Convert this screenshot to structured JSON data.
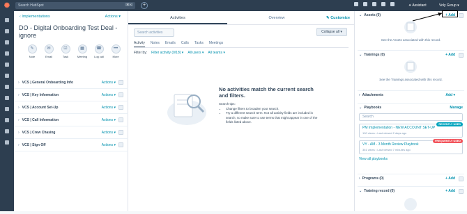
{
  "topbar": {
    "search_placeholder": "Search HubSpot",
    "search_shortcut": "⌘ K",
    "assistant_label": "Assistant",
    "account_label": "Voly Group"
  },
  "record": {
    "breadcrumb": "Implementations",
    "actions_label": "Actions",
    "title": "DO - Digital Onboarding Test Deal - ignore",
    "quick_actions": [
      {
        "label": "Note",
        "icon": "note-icon",
        "glyph": "✎"
      },
      {
        "label": "Email",
        "icon": "email-icon",
        "glyph": "✉"
      },
      {
        "label": "Task",
        "icon": "task-icon",
        "glyph": "☑"
      },
      {
        "label": "Meeting",
        "icon": "meeting-icon",
        "glyph": "▦"
      },
      {
        "label": "Log call",
        "icon": "call-icon",
        "glyph": "☎"
      },
      {
        "label": "More",
        "icon": "more-icon",
        "glyph": "•••"
      }
    ],
    "sections": [
      {
        "title": "VCS | General Onboarding Info",
        "actions": "Actions"
      },
      {
        "title": "VCS | Key Information",
        "actions": "Actions"
      },
      {
        "title": "VCS | Account Set-Up",
        "actions": "Actions"
      },
      {
        "title": "VCS | Call Information",
        "actions": "Actions"
      },
      {
        "title": "VCS | Crew Chasing",
        "actions": "Actions"
      },
      {
        "title": "VCS | Sign Off",
        "actions": "Actions"
      }
    ]
  },
  "middle": {
    "tabs": [
      "Activities",
      "Overview"
    ],
    "customize_label": "Customize",
    "search_placeholder": "Search activities",
    "collapse_label": "Collapse all",
    "subtabs": [
      "Activity",
      "Notes",
      "Emails",
      "Calls",
      "Tasks",
      "Meetings"
    ],
    "filter_by_label": "Filter by:",
    "filter_activity": "Filter activity (0/18)",
    "filter_users": "All users",
    "filter_teams": "All teams",
    "empty_title": "No activities match the current search and filters.",
    "tips_heading": "Search tips:",
    "tips": [
      "Change filters to broaden your search.",
      "Try a different search term. Not all activity fields are included in search, so make sure to use terms that might appear in one of the fields listed above."
    ]
  },
  "right": {
    "assets": {
      "title": "Assets (0)",
      "add": "+ Add",
      "empty": "See the Assets associated with this record."
    },
    "trainings": {
      "title": "Trainings (0)",
      "add": "+ Add",
      "empty": "See the Trainings associated with this record."
    },
    "attachments": {
      "title": "Attachments",
      "add": "Add"
    },
    "playbooks": {
      "title": "Playbooks",
      "manage": "Manage",
      "search_placeholder": "Search",
      "items": [
        {
          "title": "PM Implementation - NEW ACCOUNT SET-UP",
          "meta": "100 views • Last viewed 2 days ago",
          "badge": "RECENTLY USED",
          "badge_color": "#00a4bd"
        },
        {
          "title": "VY - AM - 3 Month Review Playbook",
          "meta": "361 views • Last viewed 7 minutes ago",
          "badge": "FREQUENTLY USED",
          "badge_color": "#f2545b"
        }
      ],
      "view_all": "View all playbooks"
    },
    "programs": {
      "title": "Programs (0)",
      "add": "+ Add"
    },
    "training_record": {
      "title": "Training record (0)",
      "add": "+ Add"
    }
  }
}
